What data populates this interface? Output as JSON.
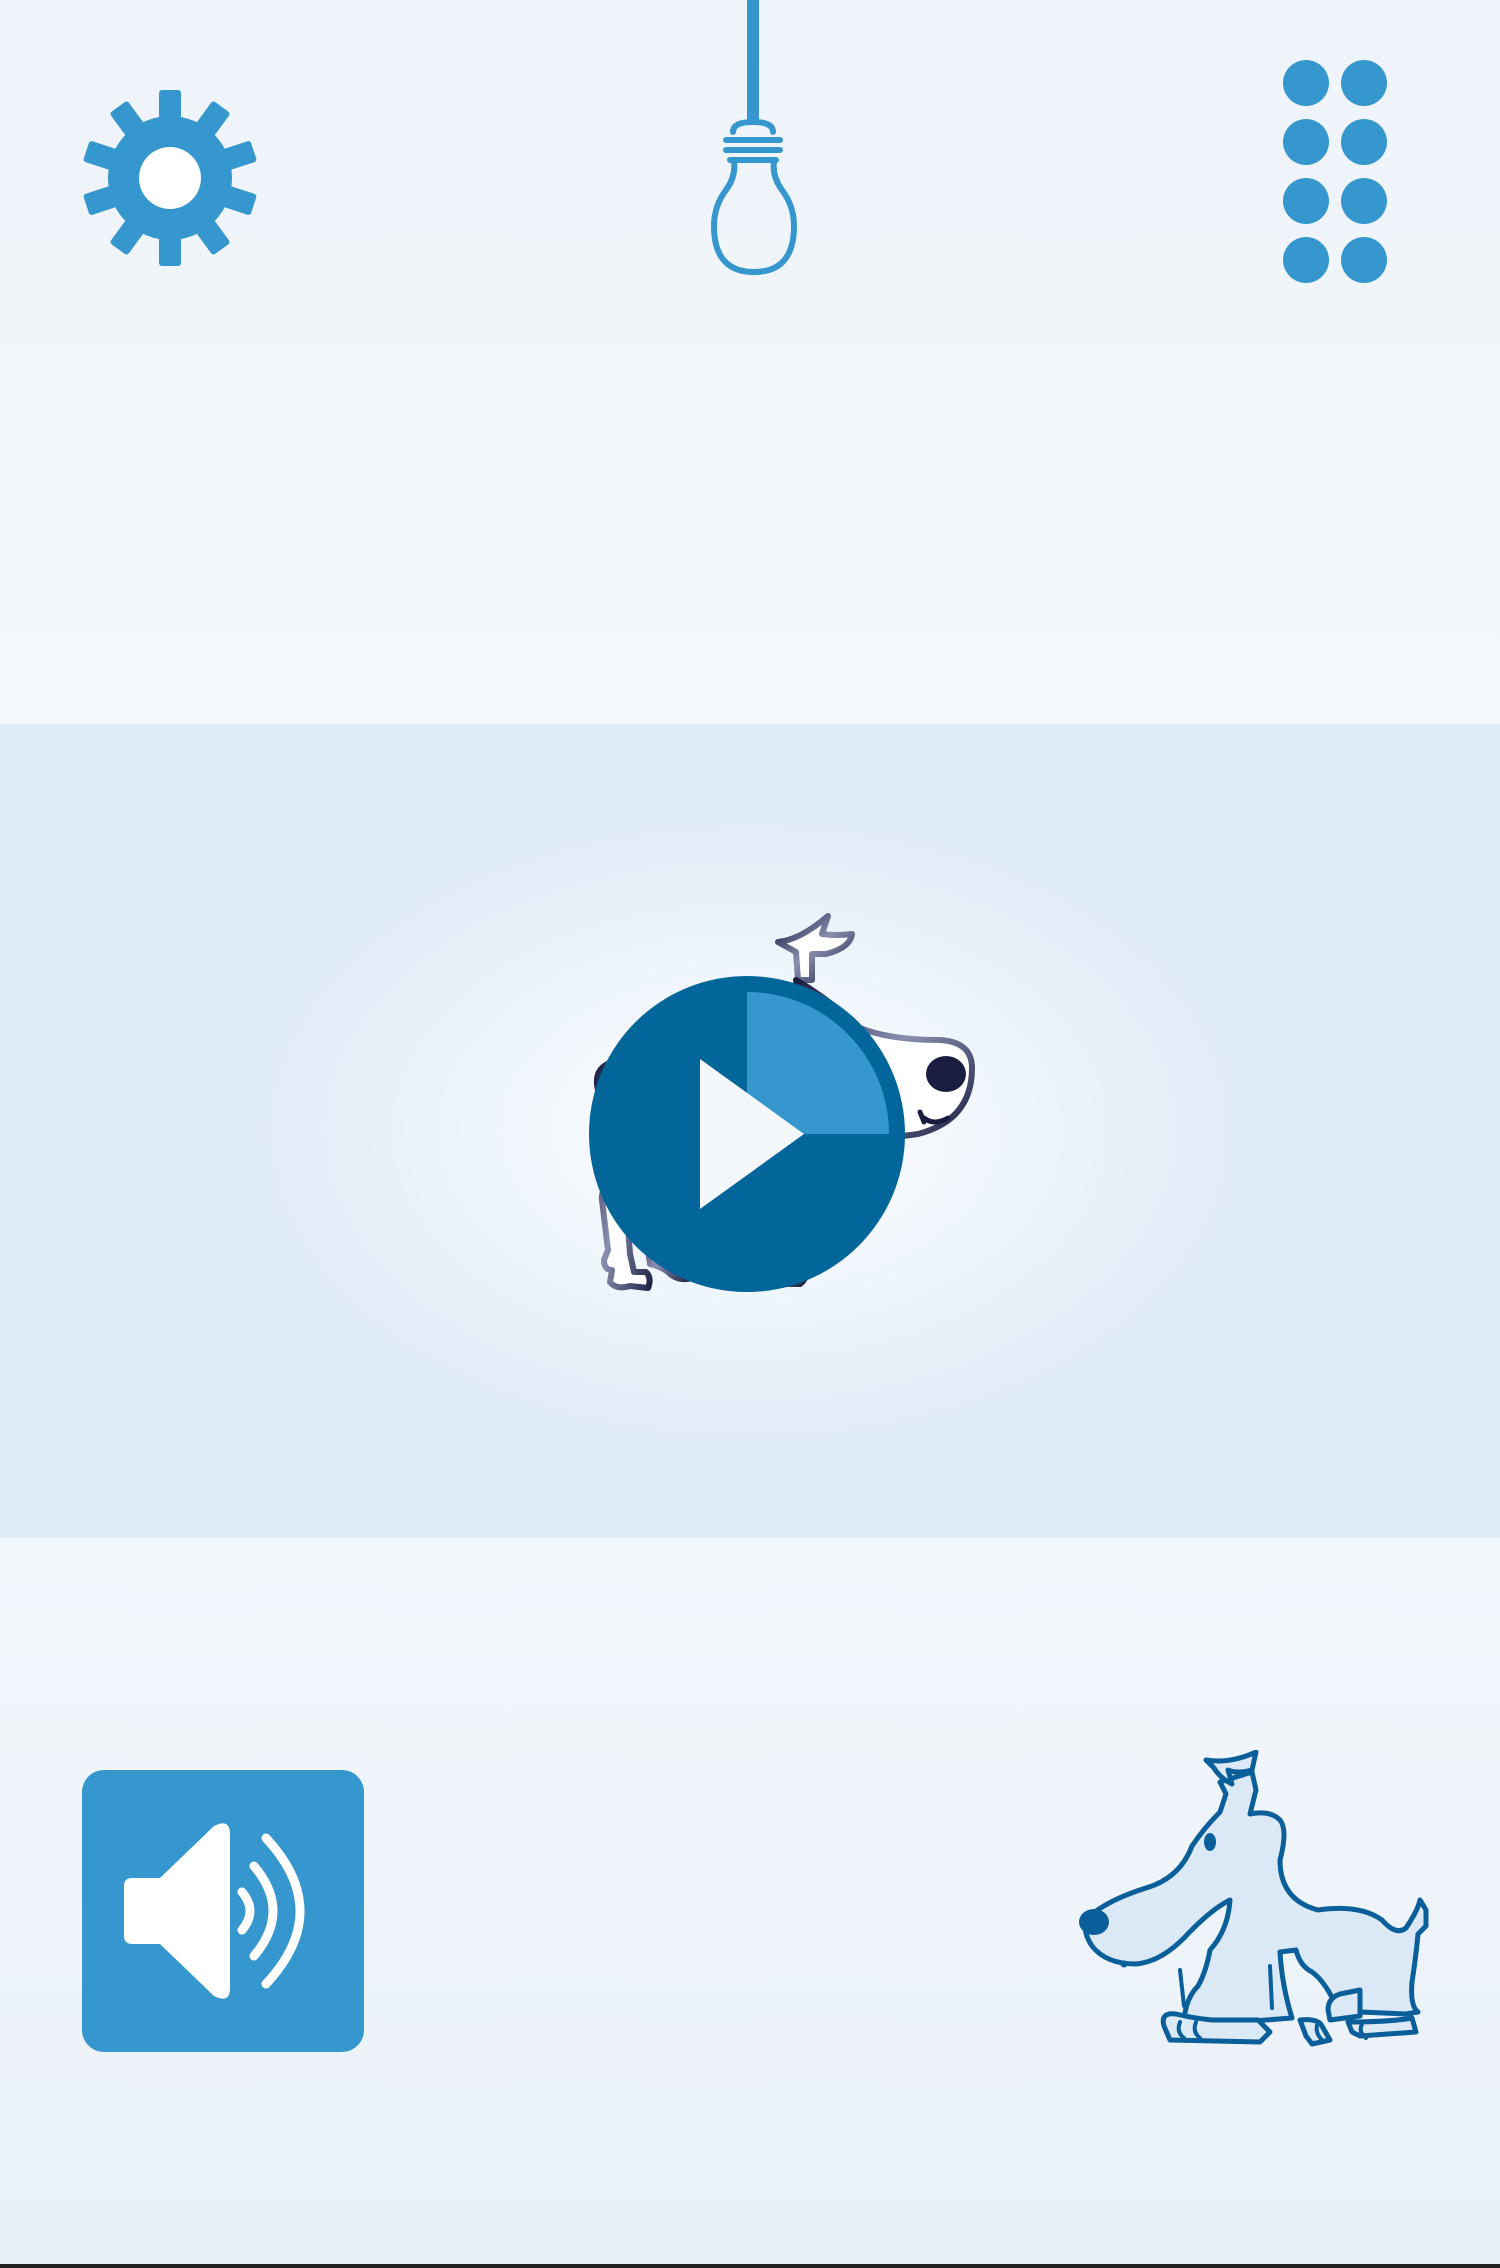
{
  "colors": {
    "accent": "#3597cd",
    "play_dark": "#02669b",
    "play_light": "#3597cd",
    "dog_outline": "#1a1d40",
    "dog_small_outline": "#0a5f9a",
    "dog_small_fill": "#dbe8f5"
  },
  "top_bar": {
    "settings_icon": "gear-icon",
    "hint_icon": "lightbulb-icon",
    "menu_icon": "grid-dots-icon"
  },
  "center": {
    "character_icon": "dog-icon",
    "play_icon": "play-icon",
    "progress": 0.25
  },
  "bottom_bar": {
    "sound_icon": "speaker-icon",
    "companion_icon": "dog-icon"
  }
}
